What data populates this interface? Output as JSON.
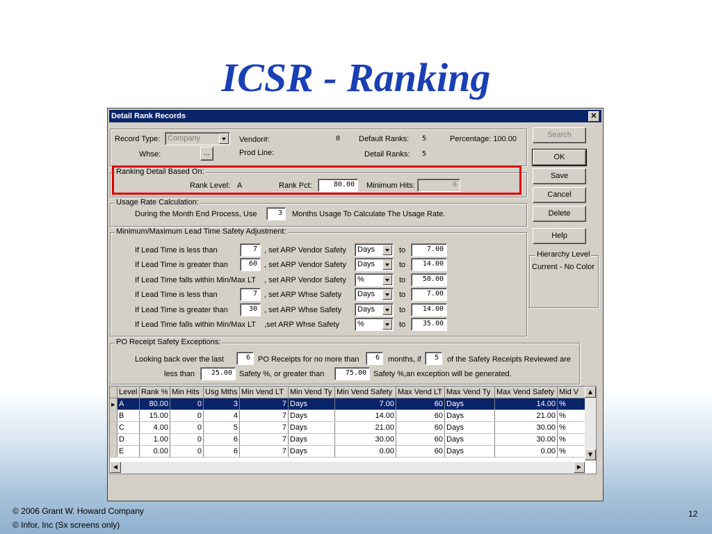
{
  "slide": {
    "title": "ICSR - Ranking",
    "footer_line1": "©  2006 Grant W. Howard Company",
    "footer_line2": "©  Infor, Inc (Sx screens only)",
    "page_number": "12"
  },
  "window": {
    "title": "Detail Rank Records",
    "close_glyph": "✕"
  },
  "header": {
    "record_type_label": "Record Type:",
    "record_type_value": "Company",
    "vendor_label": "Vendor#:",
    "vendor_value": "0",
    "default_ranks_label": "Default Ranks:",
    "default_ranks_value": "5",
    "percentage_label": "Percentage: 100.00",
    "whse_label": "Whse:",
    "whse_btn": "...",
    "prod_line_label": "Prod Line:",
    "detail_ranks_label": "Detail Ranks:",
    "detail_ranks_value": "5"
  },
  "ranking_detail": {
    "group_label": "Ranking Detail Based On:",
    "rank_level_label": "Rank Level:",
    "rank_level_value": "A",
    "rank_pct_label": "Rank Pct:",
    "rank_pct_value": "80.00",
    "min_hits_label": "Minimum Hits:",
    "min_hits_value": "0"
  },
  "usage": {
    "group_label": "Usage Rate Calculation:",
    "prefix": "During the Month End Process, Use",
    "months_value": "3",
    "suffix": "Months Usage To Calculate The Usage Rate."
  },
  "lead_time": {
    "group_label": "Minimum/Maximum Lead Time Safety Adjustment:",
    "rows": [
      {
        "cond": "If Lead Time is less than",
        "days": "7",
        "set": ", set ARP Vendor Safety",
        "unit": "Days",
        "to": "to",
        "val": "7.00"
      },
      {
        "cond": "If Lead Time is greater than",
        "days": "60",
        "set": ", set ARP Vendor Safety",
        "unit": "Days",
        "to": "to",
        "val": "14.00"
      },
      {
        "cond": "If Lead Time falls within Min/Max LT",
        "days": "",
        "set": ", set ARP Vendor Safety",
        "unit": "%",
        "to": "to",
        "val": "50.00"
      },
      {
        "cond": "If Lead Time is less than",
        "days": "7",
        "set": ", set ARP Whse Safety",
        "unit": "Days",
        "to": "to",
        "val": "7.00"
      },
      {
        "cond": "If Lead Time is greater than",
        "days": "30",
        "set": ", set ARP Whse Safety",
        "unit": "Days",
        "to": "to",
        "val": "14.00"
      },
      {
        "cond": "If Lead Time falls within Min/Max LT",
        "days": "",
        "set": ",set ARP Whse Safety",
        "unit": "%",
        "to": "to",
        "val": "35.00"
      }
    ]
  },
  "po_receipt": {
    "group_label": "PO Receipt Safety Exceptions:",
    "looking_back": "Looking back over the last",
    "receipts_value": "6",
    "receipts_text": "PO Receipts for no more than",
    "months_value": "6",
    "months_text": "months, if",
    "safety_count": "5",
    "safety_text": "of the Safety Receipts Reviewed are",
    "less_than": "less than",
    "less_value": "25.00",
    "safety_pct_text": "Safety %,  or greater than",
    "greater_value": "75.00",
    "final_text": "Safety %,an exception will be generated."
  },
  "buttons": {
    "search": "Search",
    "ok": "OK",
    "save": "Save",
    "cancel": "Cancel",
    "delete": "Delete",
    "help": "Help"
  },
  "hierarchy": {
    "group_label": "Hierarchy Level",
    "value": "Current - No Color"
  },
  "grid": {
    "columns": [
      "Level",
      "Rank %",
      "Min Hits",
      "Usg Mths",
      "Min Vend LT",
      "Min Vend Ty",
      "Min Vend Safety",
      "Max Vend LT",
      "Max Vend Ty",
      "Max Vend Safety",
      "Mid V"
    ],
    "rows": [
      [
        "A",
        "80.00",
        "0",
        "3",
        "7",
        "Days",
        "7.00",
        "60",
        "Days",
        "14.00",
        "%"
      ],
      [
        "B",
        "15.00",
        "0",
        "4",
        "7",
        "Days",
        "14.00",
        "60",
        "Days",
        "21.00",
        "%"
      ],
      [
        "C",
        "4.00",
        "0",
        "5",
        "7",
        "Days",
        "21.00",
        "60",
        "Days",
        "30.00",
        "%"
      ],
      [
        "D",
        "1.00",
        "0",
        "6",
        "7",
        "Days",
        "30.00",
        "60",
        "Days",
        "30.00",
        "%"
      ],
      [
        "E",
        "0.00",
        "0",
        "6",
        "7",
        "Days",
        "0.00",
        "60",
        "Days",
        "0.00",
        "%"
      ]
    ]
  }
}
